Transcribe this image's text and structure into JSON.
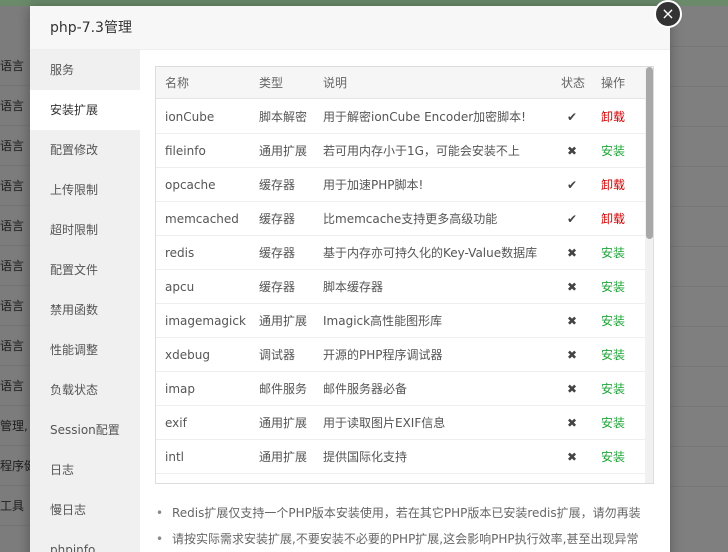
{
  "background": {
    "left_rows": [
      "语言",
      "语言",
      "语言",
      "语言",
      "语言",
      "语言",
      "语言",
      "语言",
      "语言",
      "管理,",
      "程序健",
      "工具"
    ]
  },
  "dialog": {
    "title": "php-7.3管理",
    "close_glyph": "×"
  },
  "sidebar": {
    "active_index": 1,
    "items": [
      {
        "label": "服务"
      },
      {
        "label": "安装扩展"
      },
      {
        "label": "配置修改"
      },
      {
        "label": "上传限制"
      },
      {
        "label": "超时限制"
      },
      {
        "label": "配置文件"
      },
      {
        "label": "禁用函数"
      },
      {
        "label": "性能调整"
      },
      {
        "label": "负载状态"
      },
      {
        "label": "Session配置"
      },
      {
        "label": "日志"
      },
      {
        "label": "慢日志"
      },
      {
        "label": "phpinfo"
      }
    ]
  },
  "table": {
    "headers": {
      "name": "名称",
      "type": "类型",
      "desc": "说明",
      "status": "状态",
      "op": "操作"
    },
    "installed_glyph": "✔",
    "not_installed_glyph": "✖",
    "rows": [
      {
        "name": "ionCube",
        "type": "脚本解密",
        "desc": "用于解密ionCube Encoder加密脚本!",
        "installed": true,
        "op": "卸载"
      },
      {
        "name": "fileinfo",
        "type": "通用扩展",
        "desc": "若可用内存小于1G，可能会安装不上",
        "installed": false,
        "op": "安装"
      },
      {
        "name": "opcache",
        "type": "缓存器",
        "desc": "用于加速PHP脚本!",
        "installed": true,
        "op": "卸载"
      },
      {
        "name": "memcached",
        "type": "缓存器",
        "desc": "比memcache支持更多高级功能",
        "installed": true,
        "op": "卸载"
      },
      {
        "name": "redis",
        "type": "缓存器",
        "desc": "基于内存亦可持久化的Key-Value数据库",
        "installed": false,
        "op": "安装"
      },
      {
        "name": "apcu",
        "type": "缓存器",
        "desc": "脚本缓存器",
        "installed": false,
        "op": "安装"
      },
      {
        "name": "imagemagick",
        "type": "通用扩展",
        "desc": "Imagick高性能图形库",
        "installed": false,
        "op": "安装"
      },
      {
        "name": "xdebug",
        "type": "调试器",
        "desc": "开源的PHP程序调试器",
        "installed": false,
        "op": "安装"
      },
      {
        "name": "imap",
        "type": "邮件服务",
        "desc": "邮件服务器必备",
        "installed": false,
        "op": "安装"
      },
      {
        "name": "exif",
        "type": "通用扩展",
        "desc": "用于读取图片EXIF信息",
        "installed": false,
        "op": "安装"
      },
      {
        "name": "intl",
        "type": "通用扩展",
        "desc": "提供国际化支持",
        "installed": false,
        "op": "安装"
      },
      {
        "name": "",
        "type": "",
        "desc": "",
        "installed": null,
        "op": ""
      }
    ]
  },
  "notes": [
    "Redis扩展仅支持一个PHP版本安装使用，若在其它PHP版本已安装redis扩展，请勿再装",
    "请按实际需求安装扩展,不要安装不必要的PHP扩展,这会影响PHP执行效率,甚至出现异常"
  ],
  "colors": {
    "uninstall": "#cc0000",
    "install": "#20a53a"
  }
}
